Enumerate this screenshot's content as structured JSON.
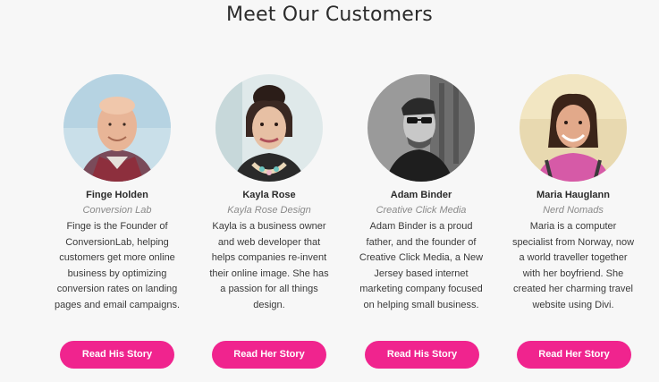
{
  "section": {
    "title": "Meet Our Customers"
  },
  "colors": {
    "accent": "#f0248e",
    "background": "#f7f7f7"
  },
  "customers": [
    {
      "name": "Finge Holden",
      "company": "Conversion Lab",
      "bio": "Finge is the Founder of ConversionLab, helping customers get more online business by optimizing conversion rates on landing pages and email campaigns.",
      "button": "Read His Story"
    },
    {
      "name": "Kayla Rose",
      "company": "Kayla Rose Design",
      "bio": "Kayla is a business owner and web developer that helps companies re-invent their online image. She has a passion for all things design.",
      "button": "Read Her Story"
    },
    {
      "name": "Adam Binder",
      "company": "Creative Click Media",
      "bio": "Adam Binder is a proud father, and the founder of Creative Click Media, a New Jersey based internet marketing company focused on helping small business.",
      "button": "Read His Story"
    },
    {
      "name": "Maria Hauglann",
      "company": "Nerd Nomads",
      "bio": "Maria is a computer specialist from Norway, now a world traveller together with her boyfriend. She created her charming travel website using Divi.",
      "button": "Read Her Story"
    }
  ]
}
